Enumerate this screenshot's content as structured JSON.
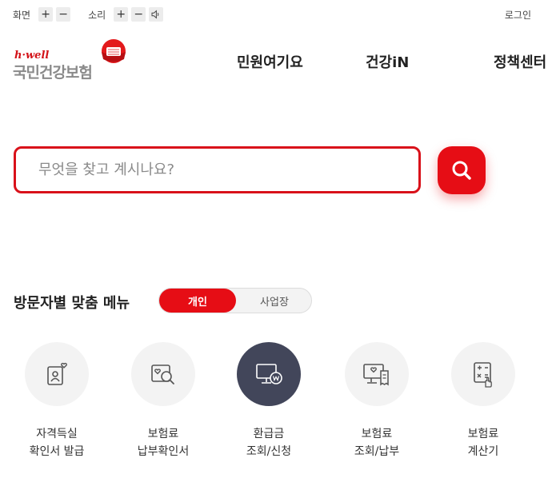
{
  "util": {
    "screen_label": "화면",
    "sound_label": "소리",
    "plus": "+",
    "minus": "−",
    "login": "로그인"
  },
  "logo": {
    "tagline": "h·well",
    "name": "국민건강보험"
  },
  "gnb": [
    {
      "label": "민원여기요"
    },
    {
      "label": "건강iN"
    },
    {
      "label": "정책센터"
    }
  ],
  "search": {
    "placeholder": "무엇을 찾고 계시나요?",
    "icon": "search-icon"
  },
  "visitor": {
    "title": "방문자별 맞춤 메뉴",
    "tabs": [
      {
        "label": "개인",
        "active": true
      },
      {
        "label": "사업장",
        "active": false
      }
    ]
  },
  "menus": [
    {
      "line1": "자격득실",
      "line2": "확인서 발급",
      "icon": "id-card-icon"
    },
    {
      "line1": "보험료",
      "line2": "납부확인서",
      "icon": "document-search-icon"
    },
    {
      "line1": "환급금",
      "line2": "조회/신청",
      "icon": "monitor-refund-icon"
    },
    {
      "line1": "보험료",
      "line2": "조회/납부",
      "icon": "monitor-receipt-icon"
    },
    {
      "line1": "보험료",
      "line2": "계산기",
      "icon": "calculator-icon"
    }
  ],
  "colors": {
    "brand_red": "#e60d15",
    "dark_circle": "#42465a",
    "light_circle": "#f3f3f3"
  }
}
